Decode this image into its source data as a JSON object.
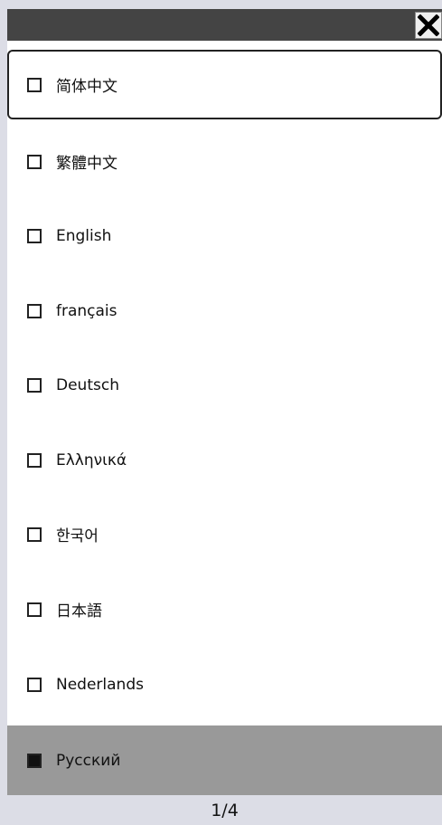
{
  "window": {
    "close_icon": "close-x-icon"
  },
  "languages": [
    {
      "label": "简体中文",
      "checked": false,
      "focused": true,
      "selected": false
    },
    {
      "label": "繁體中文",
      "checked": false,
      "focused": false,
      "selected": false
    },
    {
      "label": "English",
      "checked": false,
      "focused": false,
      "selected": false
    },
    {
      "label": "français",
      "checked": false,
      "focused": false,
      "selected": false
    },
    {
      "label": "Deutsch",
      "checked": false,
      "focused": false,
      "selected": false
    },
    {
      "label": "Ελληνικά",
      "checked": false,
      "focused": false,
      "selected": false
    },
    {
      "label": "한국어",
      "checked": false,
      "focused": false,
      "selected": false
    },
    {
      "label": "日本語",
      "checked": false,
      "focused": false,
      "selected": false
    },
    {
      "label": "Nederlands",
      "checked": false,
      "focused": false,
      "selected": false
    },
    {
      "label": "Русский",
      "checked": true,
      "focused": false,
      "selected": true
    }
  ],
  "pagination": {
    "text": "1/4"
  }
}
